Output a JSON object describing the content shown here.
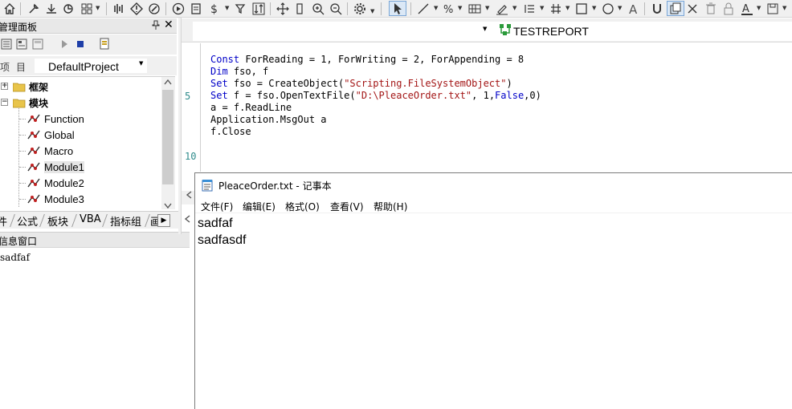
{
  "toolbar": {
    "icons": [
      "home-icon",
      "wrench-icon",
      "download-icon",
      "refresh-link-icon",
      "grid-icon",
      "chart-icon",
      "diamond-alert-icon",
      "edit-icon",
      "run-icon",
      "report-icon",
      "dollar-icon",
      "filter-icon",
      "sort-icon",
      "move-icon",
      "column-icon",
      "zoom-in-icon",
      "zoom-out-icon",
      "gear-icon",
      "pointer-icon",
      "line-icon",
      "percent-icon",
      "table-icon",
      "pen-icon",
      "list-icon",
      "hash-icon",
      "rectangle-icon",
      "circle-icon",
      "text-icon",
      "magnet-icon",
      "copy-icon",
      "delete-x-icon",
      "trash-icon",
      "lock-icon",
      "font-color-icon",
      "save-icon"
    ]
  },
  "panel": {
    "title": "管理面板",
    "pin": "ᵖ",
    "close": "✕"
  },
  "project": {
    "label": "项目",
    "value": "DefaultProject"
  },
  "tree": {
    "items": [
      {
        "label": "框架"
      },
      {
        "label": "模块"
      },
      {
        "label": "Function"
      },
      {
        "label": "Global"
      },
      {
        "label": "Macro"
      },
      {
        "label": "Module1"
      },
      {
        "label": "Module2"
      },
      {
        "label": "Module3"
      }
    ]
  },
  "tabs": [
    "件",
    "公式",
    "板块",
    "VBA",
    "指标组",
    "画"
  ],
  "info": {
    "title": "信息窗口",
    "text": "sadfaf"
  },
  "editor": {
    "object_name": "TESTREPORT",
    "line_numbers": [
      "5",
      "10"
    ],
    "lines": [
      [
        {
          "t": "kw",
          "v": "Const"
        },
        {
          "t": "n",
          "v": " ForReading = 1, ForWriting = 2, ForAppending = 8"
        }
      ],
      [
        {
          "t": "kw",
          "v": "Dim"
        },
        {
          "t": "n",
          "v": " fso, f"
        }
      ],
      [
        {
          "t": "kw",
          "v": "Set"
        },
        {
          "t": "n",
          "v": " fso = CreateObject("
        },
        {
          "t": "str",
          "v": "\"Scripting.FileSystemObject\""
        },
        {
          "t": "n",
          "v": ")"
        }
      ],
      [
        {
          "t": "kw",
          "v": "Set"
        },
        {
          "t": "n",
          "v": " f = fso.OpenTextFile("
        },
        {
          "t": "str",
          "v": "\"D:\\PleaceOrder.txt\""
        },
        {
          "t": "n",
          "v": ", 1,"
        },
        {
          "t": "kw",
          "v": "False"
        },
        {
          "t": "n",
          "v": ",0)"
        }
      ],
      [
        {
          "t": "n",
          "v": "a = f.ReadLine"
        }
      ],
      [
        {
          "t": "n",
          "v": "Application.MsgOut a"
        }
      ],
      [
        {
          "t": "n",
          "v": "f.Close"
        }
      ]
    ]
  },
  "notepad": {
    "title": "PleaceOrder.txt - 记事本",
    "menu": [
      "文件(F)",
      "编辑(E)",
      "格式(O)",
      "查看(V)",
      "帮助(H)"
    ],
    "content": [
      "sadfaf",
      "sadfasdf"
    ]
  },
  "colors": {
    "keyword": "#0000c8",
    "string": "#a31515",
    "line_number": "#2e8b8b"
  }
}
